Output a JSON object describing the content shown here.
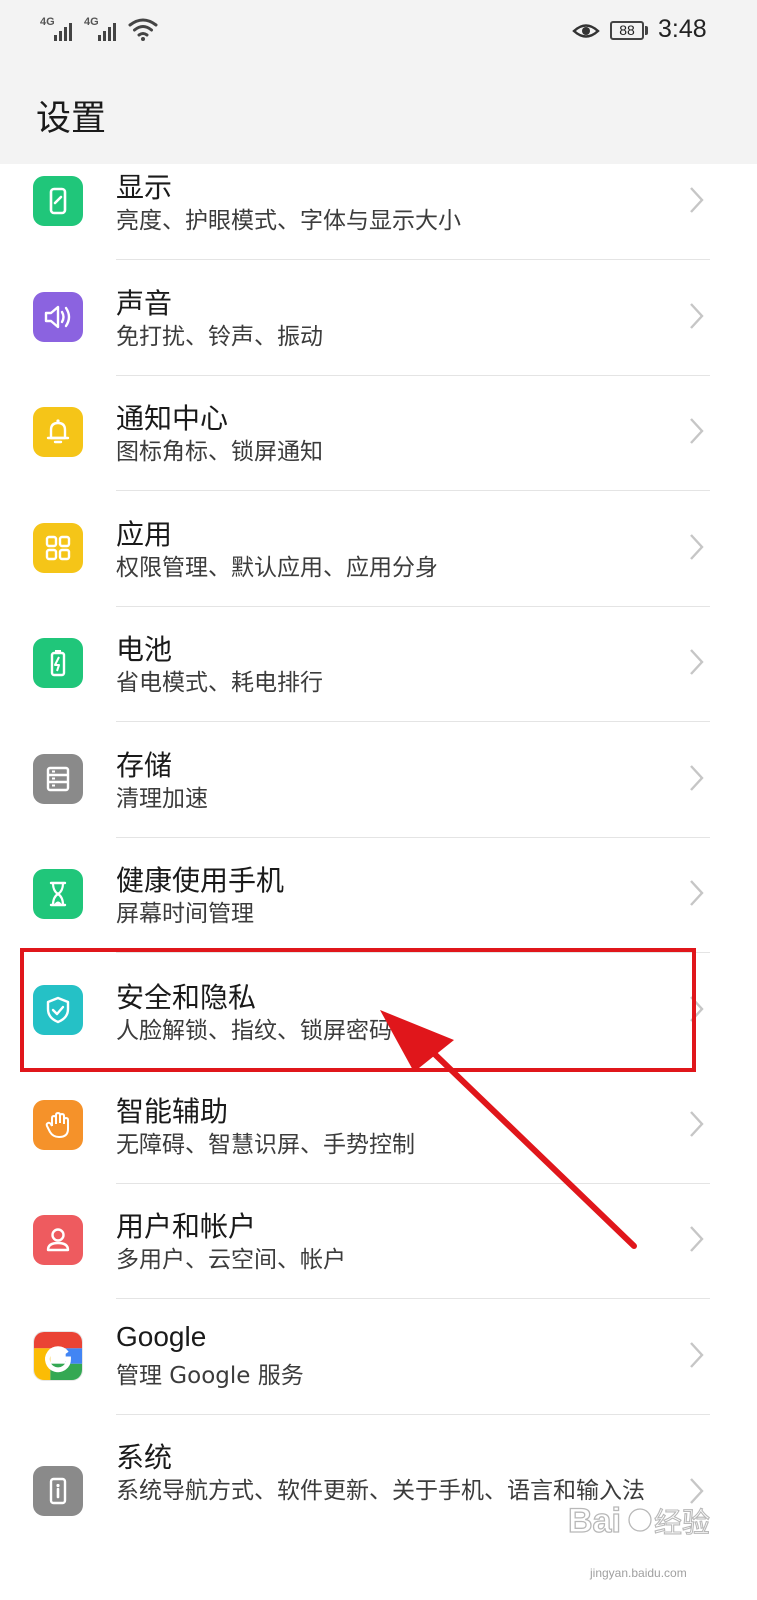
{
  "status_bar": {
    "signal1_label": "4G",
    "signal2_label": "4G",
    "battery": "88",
    "time": "3:48",
    "icons": [
      "signal-icon",
      "wifi-icon",
      "eye-comfort-icon",
      "battery-icon"
    ]
  },
  "header": {
    "title": "设置"
  },
  "settings": [
    {
      "id": "display",
      "title": "显示",
      "subtitle": "亮度、护眼模式、字体与显示大小",
      "icon": "display-icon",
      "color": "#20c67a"
    },
    {
      "id": "sound",
      "title": "声音",
      "subtitle": "免打扰、铃声、振动",
      "icon": "speaker-icon",
      "color": "#8b63e0"
    },
    {
      "id": "notifications",
      "title": "通知中心",
      "subtitle": "图标角标、锁屏通知",
      "icon": "bell-icon",
      "color": "#f5c518"
    },
    {
      "id": "apps",
      "title": "应用",
      "subtitle": "权限管理、默认应用、应用分身",
      "icon": "apps-grid-icon",
      "color": "#f5c518"
    },
    {
      "id": "battery",
      "title": "电池",
      "subtitle": "省电模式、耗电排行",
      "icon": "battery-charge-icon",
      "color": "#20c67a"
    },
    {
      "id": "storage",
      "title": "存储",
      "subtitle": "清理加速",
      "icon": "storage-icon",
      "color": "#8a8a8a"
    },
    {
      "id": "digital_balance",
      "title": "健康使用手机",
      "subtitle": "屏幕时间管理",
      "icon": "hourglass-icon",
      "color": "#20c67a"
    },
    {
      "id": "security",
      "title": "安全和隐私",
      "subtitle": "人脸解锁、指纹、锁屏密码",
      "icon": "shield-icon",
      "color": "#25c1c6"
    },
    {
      "id": "accessibility",
      "title": "智能辅助",
      "subtitle": "无障碍、智慧识屏、手势控制",
      "icon": "hand-icon",
      "color": "#f5922a"
    },
    {
      "id": "users",
      "title": "用户和帐户",
      "subtitle": "多用户、云空间、帐户",
      "icon": "user-icon",
      "color": "#ee5b5f"
    },
    {
      "id": "google",
      "title": "Google",
      "subtitle": "管理 Google 服务",
      "icon": "google-icon",
      "color": "#ffffff"
    },
    {
      "id": "system",
      "title": "系统",
      "subtitle": "系统导航方式、软件更新、关于手机、语言和输入法",
      "icon": "system-info-icon",
      "color": "#8a8a8a"
    }
  ],
  "annotation": {
    "highlighted_item": "security",
    "color": "#e0161b"
  },
  "watermark": {
    "brand": "Baidu 经验",
    "url": "jingyan.baidu.com"
  }
}
